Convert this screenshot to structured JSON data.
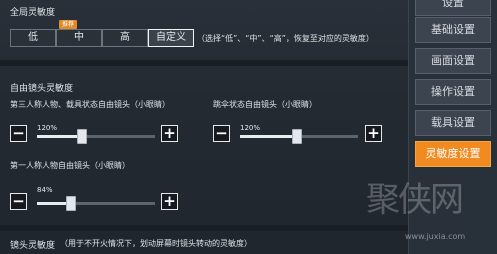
{
  "global": {
    "title": "全局灵敏度",
    "options": [
      "低",
      "中",
      "高",
      "自定义"
    ],
    "selected_index": 3,
    "recommend_badge": "推荐",
    "hint": "（选择“低”、“中”、“高”，恢复至对应的灵敏度）"
  },
  "free_camera": {
    "title": "自由镜头灵敏度",
    "sliders": [
      {
        "label": "第三人称人物、载具状态自由镜头（小眼睛）",
        "value_text": "120%",
        "fraction": 0.38
      },
      {
        "label": "跳伞状态自由镜头（小眼睛）",
        "value_text": "120%",
        "fraction": 0.48
      },
      {
        "label": "第一人称人物自由镜头（小眼睛）",
        "value_text": "84%",
        "fraction": 0.29
      }
    ],
    "minus": "−",
    "plus": "+"
  },
  "lens": {
    "title": "镜头灵敏度",
    "hint": "（用于不开火情况下，划动屏幕时镜头转动的灵敏度）"
  },
  "sidebar": {
    "items": [
      {
        "label": "设置"
      },
      {
        "label": "基础设置"
      },
      {
        "label": "画面设置"
      },
      {
        "label": "操作设置"
      },
      {
        "label": "载具设置"
      },
      {
        "label": "灵敏度设置"
      }
    ],
    "active_index": 5
  },
  "watermark": {
    "text": "聚侠网",
    "url": "www.juxia.com"
  },
  "colors": {
    "accent": "#f18a1f",
    "background": "#242a32"
  }
}
